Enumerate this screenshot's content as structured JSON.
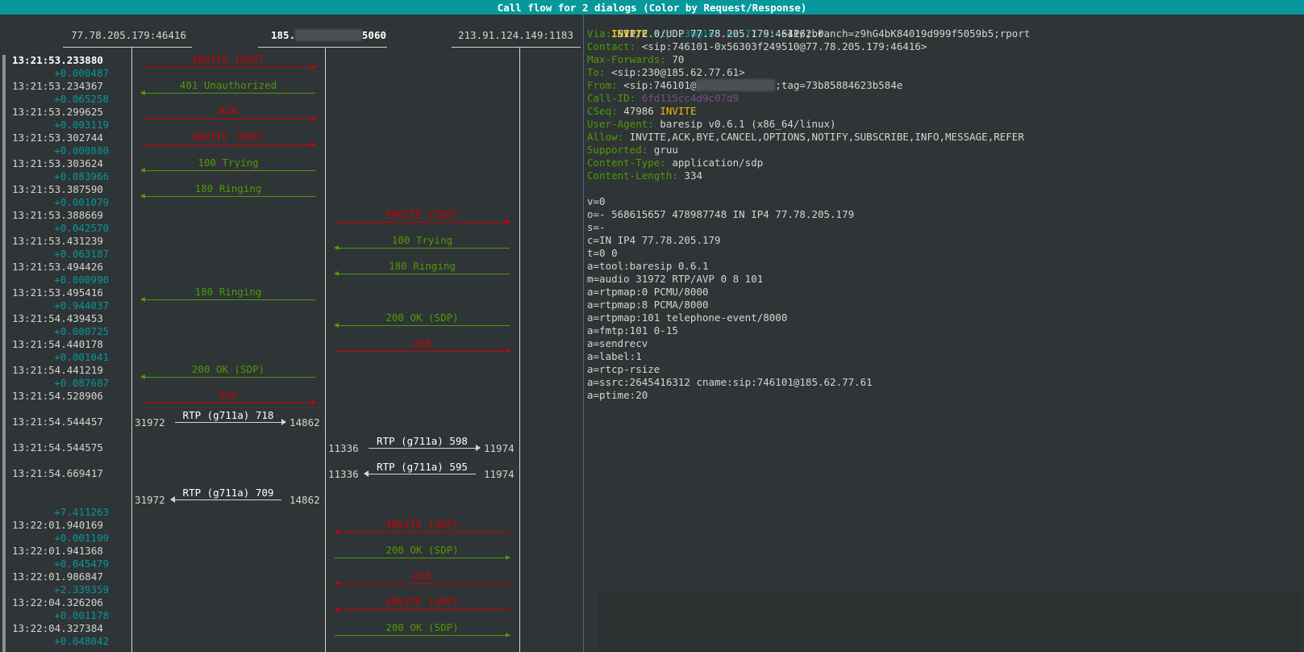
{
  "window": {
    "title": "Call flow for 2 dialogs (Color by Request/Response)"
  },
  "columns": [
    {
      "label": "77.78.205.179:46416",
      "active": false
    },
    {
      "label": "185.",
      "label_tail": "5060",
      "redacted": "xx.xxx.xxx.",
      "active": true
    },
    {
      "label": "213.91.124.149:1183",
      "active": false
    }
  ],
  "rows": [
    {
      "ts": "13:21:53.233880",
      "delta": "+0.000487",
      "label": "INVITE (SDP)",
      "kind": "request",
      "color": "#cc0000",
      "from": 0,
      "to": 1
    },
    {
      "ts": "13:21:53.234367",
      "delta": "+0.065258",
      "label": "401 Unauthorized",
      "kind": "response",
      "color": "#4e9a06",
      "from": 1,
      "to": 0
    },
    {
      "ts": "13:21:53.299625",
      "delta": "+0.003119",
      "label": "ACK",
      "kind": "request",
      "color": "#cc0000",
      "from": 0,
      "to": 1
    },
    {
      "ts": "13:21:53.302744",
      "delta": "+0.000880",
      "label": "INVITE (SDP)",
      "kind": "request",
      "color": "#cc0000",
      "from": 0,
      "to": 1
    },
    {
      "ts": "13:21:53.303624",
      "delta": "+0.083966",
      "label": "100 Trying",
      "kind": "response",
      "color": "#4e9a06",
      "from": 1,
      "to": 0
    },
    {
      "ts": "13:21:53.387590",
      "delta": "+0.001079",
      "label": "180 Ringing",
      "kind": "response",
      "color": "#4e9a06",
      "from": 1,
      "to": 0
    },
    {
      "ts": "13:21:53.388669",
      "delta": "+0.042570",
      "label": "INVITE (SDP)",
      "kind": "request",
      "color": "#cc0000",
      "from": 1,
      "to": 2
    },
    {
      "ts": "13:21:53.431239",
      "delta": "+0.063187",
      "label": "100 Trying",
      "kind": "response",
      "color": "#4e9a06",
      "from": 2,
      "to": 1
    },
    {
      "ts": "13:21:53.494426",
      "delta": "+0.000990",
      "label": "180 Ringing",
      "kind": "response",
      "color": "#4e9a06",
      "from": 2,
      "to": 1
    },
    {
      "ts": "13:21:53.495416",
      "delta": "+0.944037",
      "label": "180 Ringing",
      "kind": "response",
      "color": "#4e9a06",
      "from": 1,
      "to": 0
    },
    {
      "ts": "13:21:54.439453",
      "delta": "+0.000725",
      "label": "200 OK (SDP)",
      "kind": "response",
      "color": "#4e9a06",
      "from": 2,
      "to": 1
    },
    {
      "ts": "13:21:54.440178",
      "delta": "+0.001041",
      "label": "ACK",
      "kind": "request",
      "color": "#cc0000",
      "from": 1,
      "to": 2
    },
    {
      "ts": "13:21:54.441219",
      "delta": "+0.087687",
      "label": "200 OK (SDP)",
      "kind": "response",
      "color": "#4e9a06",
      "from": 1,
      "to": 0
    },
    {
      "ts": "13:21:54.528906",
      "delta": "",
      "label": "ACK",
      "kind": "request",
      "color": "#cc0000",
      "from": 0,
      "to": 1
    },
    {
      "ts": "13:21:54.544457",
      "delta": "",
      "label": "RTP (g711a) 718",
      "kind": "rtp",
      "color": "#d3d7cf",
      "from": 0,
      "to": 1,
      "src_port": "31972",
      "dst_port": "14862"
    },
    {
      "ts": "13:21:54.544575",
      "delta": "",
      "label": "RTP (g711a) 598",
      "kind": "rtp",
      "color": "#d3d7cf",
      "from": 1,
      "to": 2,
      "src_port": "11336",
      "dst_port": "11974"
    },
    {
      "ts": "13:21:54.669417",
      "delta": "",
      "label": "RTP (g711a) 595",
      "kind": "rtp",
      "color": "#d3d7cf",
      "from": 2,
      "to": 1,
      "src_port": "11336",
      "dst_port": "11974"
    },
    {
      "ts": "",
      "delta": "+7.411263",
      "label": "RTP (g711a) 709",
      "kind": "rtp",
      "color": "#d3d7cf",
      "from": 1,
      "to": 0,
      "src_port": "31972",
      "dst_port": "14862"
    },
    {
      "ts": "13:22:01.940169",
      "delta": "+0.001199",
      "label": "INVITE (SDP)",
      "kind": "request",
      "color": "#cc0000",
      "from": 2,
      "to": 1
    },
    {
      "ts": "13:22:01.941368",
      "delta": "+0.045479",
      "label": "200 OK (SDP)",
      "kind": "response",
      "color": "#4e9a06",
      "from": 1,
      "to": 2
    },
    {
      "ts": "13:22:01.986847",
      "delta": "+2.339359",
      "label": "ACK",
      "kind": "request",
      "color": "#cc0000",
      "from": 2,
      "to": 1
    },
    {
      "ts": "13:22:04.326206",
      "delta": "+0.001178",
      "label": "INVITE (SDP)",
      "kind": "request",
      "color": "#cc0000",
      "from": 2,
      "to": 1
    },
    {
      "ts": "13:22:04.327384",
      "delta": "+0.048042",
      "label": "200 OK (SDP)",
      "kind": "response",
      "color": "#4e9a06",
      "from": 1,
      "to": 2
    }
  ],
  "detail": {
    "request_line": {
      "method": "INVITE",
      "uri": "sip:230@185.62.77.61",
      "version": "SIP/2.0"
    },
    "headers": [
      {
        "name": "Via:",
        "value": "SIP/2.0/UDP 77.78.205.179:46416;branch=z9hG4bK84019d999f5059b5;rport"
      },
      {
        "name": "Contact:",
        "value": "<sip:746101-0x56303f249510@77.78.205.179:46416>"
      },
      {
        "name": "Max-Forwards:",
        "value": "70"
      },
      {
        "name": "To:",
        "value": "<sip:230@185.62.77.61>"
      },
      {
        "name": "From:",
        "value": "<sip:746101@",
        "redacted": "xxx.xx.xx.xxx",
        "value_tail": ";tag=73b85884623b584e"
      },
      {
        "name": "Call-ID:",
        "value": "6fd115cc4d9c07d9",
        "style": "purple"
      },
      {
        "name": "CSeq:",
        "value": "47986 ",
        "value_tail": "INVITE",
        "tail_style": "yellow"
      },
      {
        "name": "User-Agent:",
        "value": "baresip v0.6.1 (x86_64/linux)"
      },
      {
        "name": "Allow:",
        "value": "INVITE,ACK,BYE,CANCEL,OPTIONS,NOTIFY,SUBSCRIBE,INFO,MESSAGE,REFER"
      },
      {
        "name": "Supported:",
        "value": "gruu"
      },
      {
        "name": "Content-Type:",
        "value": "application/sdp"
      },
      {
        "name": "Content-Length:",
        "value": "334"
      }
    ],
    "body": [
      "v=0",
      "o=- 568615657 478987748 IN IP4 77.78.205.179",
      "s=-",
      "c=IN IP4 77.78.205.179",
      "t=0 0",
      "a=tool:baresip 0.6.1",
      "m=audio 31972 RTP/AVP 0 8 101",
      "a=rtpmap:0 PCMU/8000",
      "a=rtpmap:8 PCMA/8000",
      "a=rtpmap:101 telephone-event/8000",
      "a=fmtp:101 0-15",
      "a=sendrecv",
      "a=label:1",
      "a=rtcp-rsize",
      "a=ssrc:2645416312 cname:sip:746101@185.62.77.61",
      "a=ptime:20"
    ]
  }
}
